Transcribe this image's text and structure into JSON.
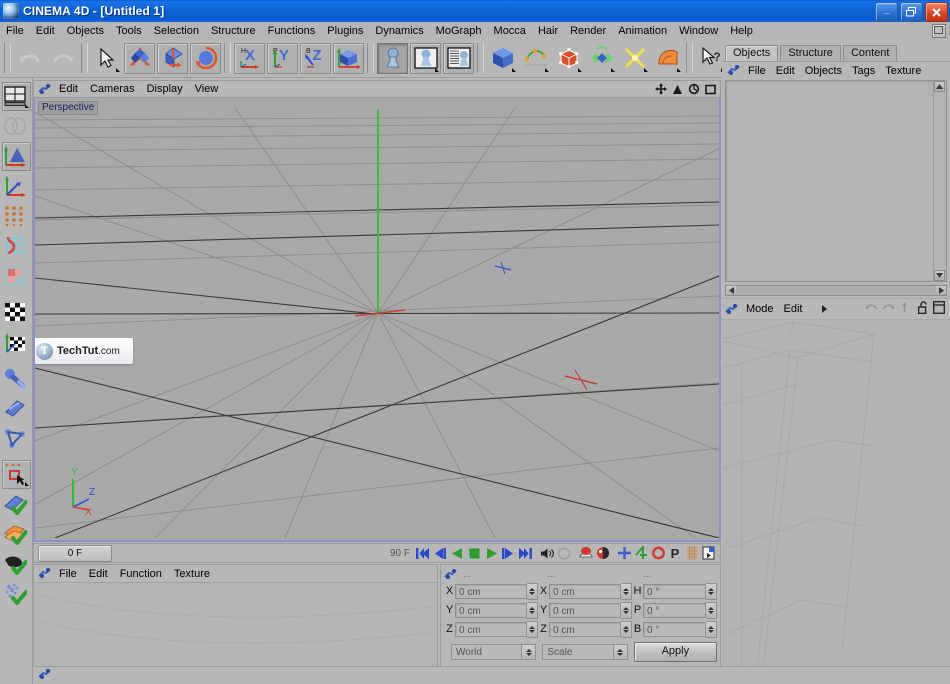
{
  "window": {
    "title": "CINEMA 4D - [Untitled 1]",
    "minimize_label": "_",
    "maximize_label": "❐",
    "close_label": "✕"
  },
  "menubar": {
    "items": [
      "File",
      "Edit",
      "Objects",
      "Tools",
      "Selection",
      "Structure",
      "Functions",
      "Plugins",
      "Dynamics",
      "MoGraph",
      "Mocca",
      "Hair",
      "Render",
      "Animation",
      "Window",
      "Help"
    ]
  },
  "toolbar": {
    "groups": [
      {
        "name": "history",
        "buttons": [
          {
            "label": "Undo",
            "icon": "undo-icon",
            "framed": false,
            "dropdown": false,
            "disabled": true
          },
          {
            "label": "Redo",
            "icon": "redo-icon",
            "framed": false,
            "dropdown": false,
            "disabled": true
          }
        ]
      },
      {
        "name": "transform",
        "buttons": [
          {
            "label": "Select",
            "icon": "cursor-select-icon",
            "framed": false,
            "dropdown": true
          },
          {
            "label": "Move",
            "icon": "move-axes-icon",
            "framed": true,
            "dropdown": false
          },
          {
            "label": "Scale",
            "icon": "scale-icon",
            "framed": true,
            "dropdown": false
          },
          {
            "label": "Rotate",
            "icon": "rotate-icon",
            "framed": true,
            "dropdown": false
          }
        ]
      },
      {
        "name": "axis-locks",
        "buttons": [
          {
            "label": "X Axis",
            "icon": "axis-x-icon",
            "framed": true,
            "dropdown": false
          },
          {
            "label": "Y Axis",
            "icon": "axis-y-icon",
            "framed": true,
            "dropdown": false
          },
          {
            "label": "Z Axis",
            "icon": "axis-z-icon",
            "framed": true,
            "dropdown": false
          },
          {
            "label": "World / Object Coordinates",
            "icon": "world-coord-icon",
            "framed": true,
            "dropdown": false
          }
        ]
      },
      {
        "name": "render",
        "buttons": [
          {
            "label": "Render View",
            "icon": "render-view-icon",
            "framed": true,
            "dropdown": false,
            "pressed": true
          },
          {
            "label": "Render to Picture Viewer",
            "icon": "render-picture-icon",
            "framed": true,
            "dropdown": true
          },
          {
            "label": "Render Settings",
            "icon": "render-settings-icon",
            "framed": true,
            "dropdown": false
          }
        ]
      },
      {
        "name": "objects",
        "buttons": [
          {
            "label": "Add Cube Object",
            "icon": "cube-icon",
            "framed": false,
            "dropdown": true
          },
          {
            "label": "Add Spline",
            "icon": "spline-icon",
            "framed": false,
            "dropdown": true
          },
          {
            "label": "Add HyperNURBS Object",
            "icon": "hypernurbs-icon",
            "framed": false,
            "dropdown": true
          },
          {
            "label": "Add Array Object",
            "icon": "array-icon",
            "framed": false,
            "dropdown": true
          },
          {
            "label": "Add Bend Object",
            "icon": "deformer-icon",
            "framed": false,
            "dropdown": true
          },
          {
            "label": "Add Floor Object",
            "icon": "scene-icon",
            "framed": false,
            "dropdown": true
          }
        ]
      },
      {
        "name": "help",
        "buttons": [
          {
            "label": "Help Cursor",
            "icon": "cursor-help-icon",
            "framed": false,
            "dropdown": true
          },
          {
            "label": "Scene Help",
            "icon": "scene-help-icon",
            "framed": false,
            "dropdown": true
          }
        ]
      }
    ]
  },
  "left_toolbar": {
    "buttons": [
      {
        "label": "Layout / Configure Views",
        "icon": "layout-views-icon",
        "framed": true,
        "dropdown": true
      },
      {
        "label": "Make Editable",
        "icon": "make-editable-icon",
        "framed": false,
        "dropdown": false,
        "disabled": true
      },
      {
        "label": "Model Mode",
        "icon": "model-mode-icon",
        "framed": true,
        "dropdown": false
      },
      {
        "label": "Object Axis Mode",
        "icon": "object-axis-icon",
        "framed": false,
        "dropdown": false
      },
      {
        "label": "Point Mode",
        "icon": "point-mode-icon",
        "framed": false,
        "dropdown": false
      },
      {
        "label": "Edge Mode",
        "icon": "edge-mode-icon",
        "framed": false,
        "dropdown": false
      },
      {
        "label": "Polygon Mode",
        "icon": "polygon-mode-icon",
        "framed": false,
        "dropdown": false
      },
      {
        "label": "Texture Mode",
        "icon": "texture-mode-icon",
        "framed": false,
        "dropdown": false
      },
      {
        "label": "Texture Axis Mode",
        "icon": "texture-axis-icon",
        "framed": false,
        "dropdown": false
      },
      {
        "label": "Animation Mode",
        "icon": "animation-mode-icon",
        "framed": false,
        "dropdown": false
      },
      {
        "label": "Use Object Tool",
        "icon": "object-tool-icon",
        "framed": false,
        "dropdown": false
      },
      {
        "label": "Use Model Tool",
        "icon": "model-tool-icon",
        "framed": false,
        "dropdown": false
      },
      {
        "label": "Enable Axis Modification",
        "icon": "axis-modify-icon",
        "framed": true,
        "dropdown": true
      },
      {
        "label": "Viewport Solo Single",
        "icon": "solo-single-icon",
        "framed": false,
        "dropdown": false
      },
      {
        "label": "Viewport Solo Hierarchy",
        "icon": "solo-hierarchy-icon",
        "framed": false,
        "dropdown": false
      },
      {
        "label": "Viewport Solo Off",
        "icon": "solo-off-icon",
        "framed": false,
        "dropdown": false
      },
      {
        "label": "Enable Deformers",
        "icon": "deformers-toggle-icon",
        "framed": false,
        "dropdown": false
      }
    ]
  },
  "viewport": {
    "menu": [
      "Edit",
      "Cameras",
      "Display",
      "View"
    ],
    "corner_icons": [
      "pan-icon",
      "zoom-icon",
      "rotate-view-icon",
      "maximize-view-icon"
    ],
    "label": "Perspective",
    "axis_labels": {
      "x": "X",
      "y": "Y",
      "z": "Z"
    },
    "watermark": {
      "text": "TechTut",
      ".suffix": ".com",
      "logo_letter": "T"
    }
  },
  "timeline": {
    "current_frame": "0 F",
    "end_frame": "90 F",
    "controls": [
      {
        "name": "go-to-start-button",
        "icon": "skip-start-icon"
      },
      {
        "name": "previous-key-button",
        "icon": "prev-key-icon"
      },
      {
        "name": "play-backwards-button",
        "icon": "play-back-icon"
      },
      {
        "name": "stop-button",
        "icon": "stop-icon"
      },
      {
        "name": "play-forwards-button",
        "icon": "play-forward-icon"
      },
      {
        "name": "next-key-button",
        "icon": "next-key-icon"
      },
      {
        "name": "go-to-end-button",
        "icon": "skip-end-icon"
      },
      {
        "name": "sound-toggle-button",
        "icon": "speaker-icon"
      },
      {
        "name": "loop-button",
        "icon": "loop-icon"
      },
      {
        "name": "record-active-objects-button",
        "icon": "record-icon"
      },
      {
        "name": "autokeying-button",
        "icon": "autokey-icon"
      },
      {
        "name": "keyframe-position-button",
        "icon": "key-position-icon"
      },
      {
        "name": "keyframe-scale-button",
        "icon": "key-scale-icon"
      },
      {
        "name": "keyframe-rotation-button",
        "icon": "key-rotation-icon"
      },
      {
        "name": "keyframe-parameter-button",
        "icon": "key-param-icon"
      },
      {
        "name": "keyframe-pla-button",
        "icon": "key-pla-icon"
      },
      {
        "name": "animation-layers-button",
        "icon": "anim-layer-icon"
      }
    ]
  },
  "materials": {
    "title_icon": "materials-icon",
    "menu": [
      "File",
      "Edit",
      "Function",
      "Texture"
    ]
  },
  "coordinates": {
    "title_icon": "coordinates-icon",
    "column_headers": [
      "...",
      "...",
      "..."
    ],
    "rows": [
      {
        "pos_label": "X",
        "pos_value": "0 cm",
        "size_label": "X",
        "size_value": "0 cm",
        "rot_label": "H",
        "rot_value": "0 °"
      },
      {
        "pos_label": "Y",
        "pos_value": "0 cm",
        "size_label": "Y",
        "size_value": "0 cm",
        "rot_label": "P",
        "rot_value": "0 °"
      },
      {
        "pos_label": "Z",
        "pos_value": "0 cm",
        "size_label": "Z",
        "size_value": "0 cm",
        "rot_label": "B",
        "rot_value": "0 °"
      }
    ],
    "system_dropdown": "World",
    "mode_dropdown": "Scale",
    "apply_label": "Apply"
  },
  "objects_panel": {
    "tabs": [
      {
        "label": "Objects",
        "active": true
      },
      {
        "label": "Structure",
        "active": false
      },
      {
        "label": "Content",
        "active": false
      }
    ],
    "menu": [
      "File",
      "Edit",
      "Objects",
      "Tags",
      "Texture"
    ],
    "mode_row": {
      "icon": "attributes-icon",
      "items": [
        "Mode",
        "Edit"
      ],
      "lock_icon": "lock-open-icon",
      "panel_icon": "panel-icon"
    }
  },
  "colors": {
    "window_chrome": "#b7b7b7",
    "titlebar_blue": "#0c63d6",
    "viewport_bg": "#a9a9a9",
    "viewport_border": "#8f8fcf",
    "axis_x": "#d04030",
    "axis_y": "#3cc03c",
    "axis_z": "#3050d0",
    "field_bg": "#b9b9b9"
  }
}
